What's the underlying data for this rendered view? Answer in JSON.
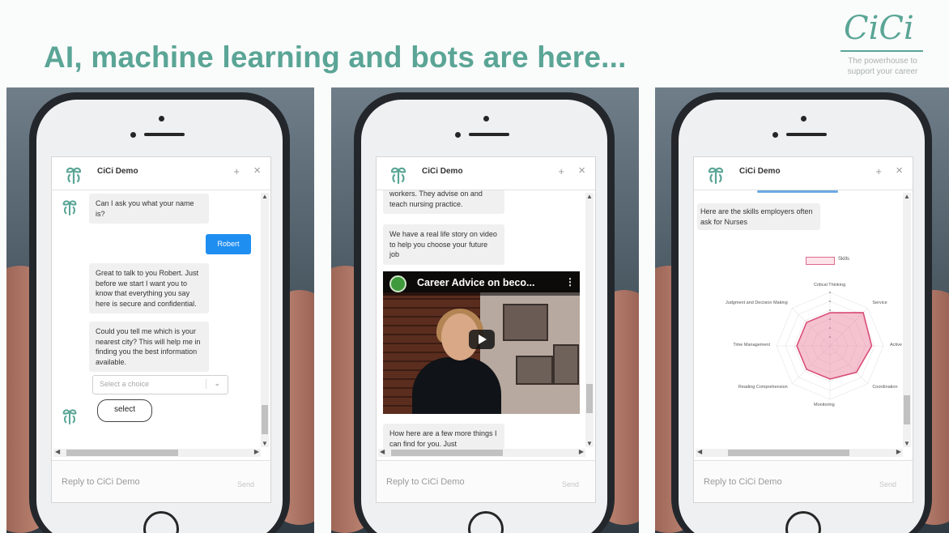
{
  "slide": {
    "title": "AI, machine learning and bots are here...",
    "logo": {
      "name": "CiCi",
      "tagline": "The powerhouse to support your career",
      "color": "#5aa596"
    }
  },
  "chat": {
    "title": "CiCi Demo",
    "minimize_icon": "+",
    "close_icon": "×",
    "reply_placeholder": "Reply to CiCi Demo",
    "send_label": "Send",
    "user_bubble_color": "#1f8ef1"
  },
  "phone1": {
    "messages": [
      {
        "from": "bot",
        "text": "Can I ask you what your name is?"
      },
      {
        "from": "user",
        "text": "Robert"
      },
      {
        "from": "bot",
        "text": "Great to talk to you Robert. Just before we start I want you to know that everything you say here is secure and confidential."
      },
      {
        "from": "bot",
        "text": "Could you tell me which is your nearest city? This will help me in finding you the best information available."
      }
    ],
    "select_placeholder": "Select a choice",
    "select_button": "select"
  },
  "phone2": {
    "messages": [
      {
        "from": "bot",
        "text": "workers. They advise on and teach nursing practice."
      },
      {
        "from": "bot",
        "text": "We have a real life story on video to help you choose your future job"
      },
      {
        "from": "bot",
        "text": "How here are a few more things I can find for you. Just"
      }
    ],
    "video_title": "Career Advice on beco..."
  },
  "phone3": {
    "intro": "Here are the skills employers often ask for Nurses",
    "chart_data": {
      "type": "radar",
      "legend": [
        "Skills"
      ],
      "series_color": "#d94f77",
      "axes": [
        "Critical Thinking",
        "Service",
        "Active",
        "Coordination",
        "Monitoring",
        "Reading Comprehension",
        "Time Management",
        "Judgment and Decision Making"
      ],
      "values": [
        0.62,
        0.88,
        0.78,
        0.7,
        0.62,
        0.62,
        0.62,
        0.62
      ]
    }
  }
}
